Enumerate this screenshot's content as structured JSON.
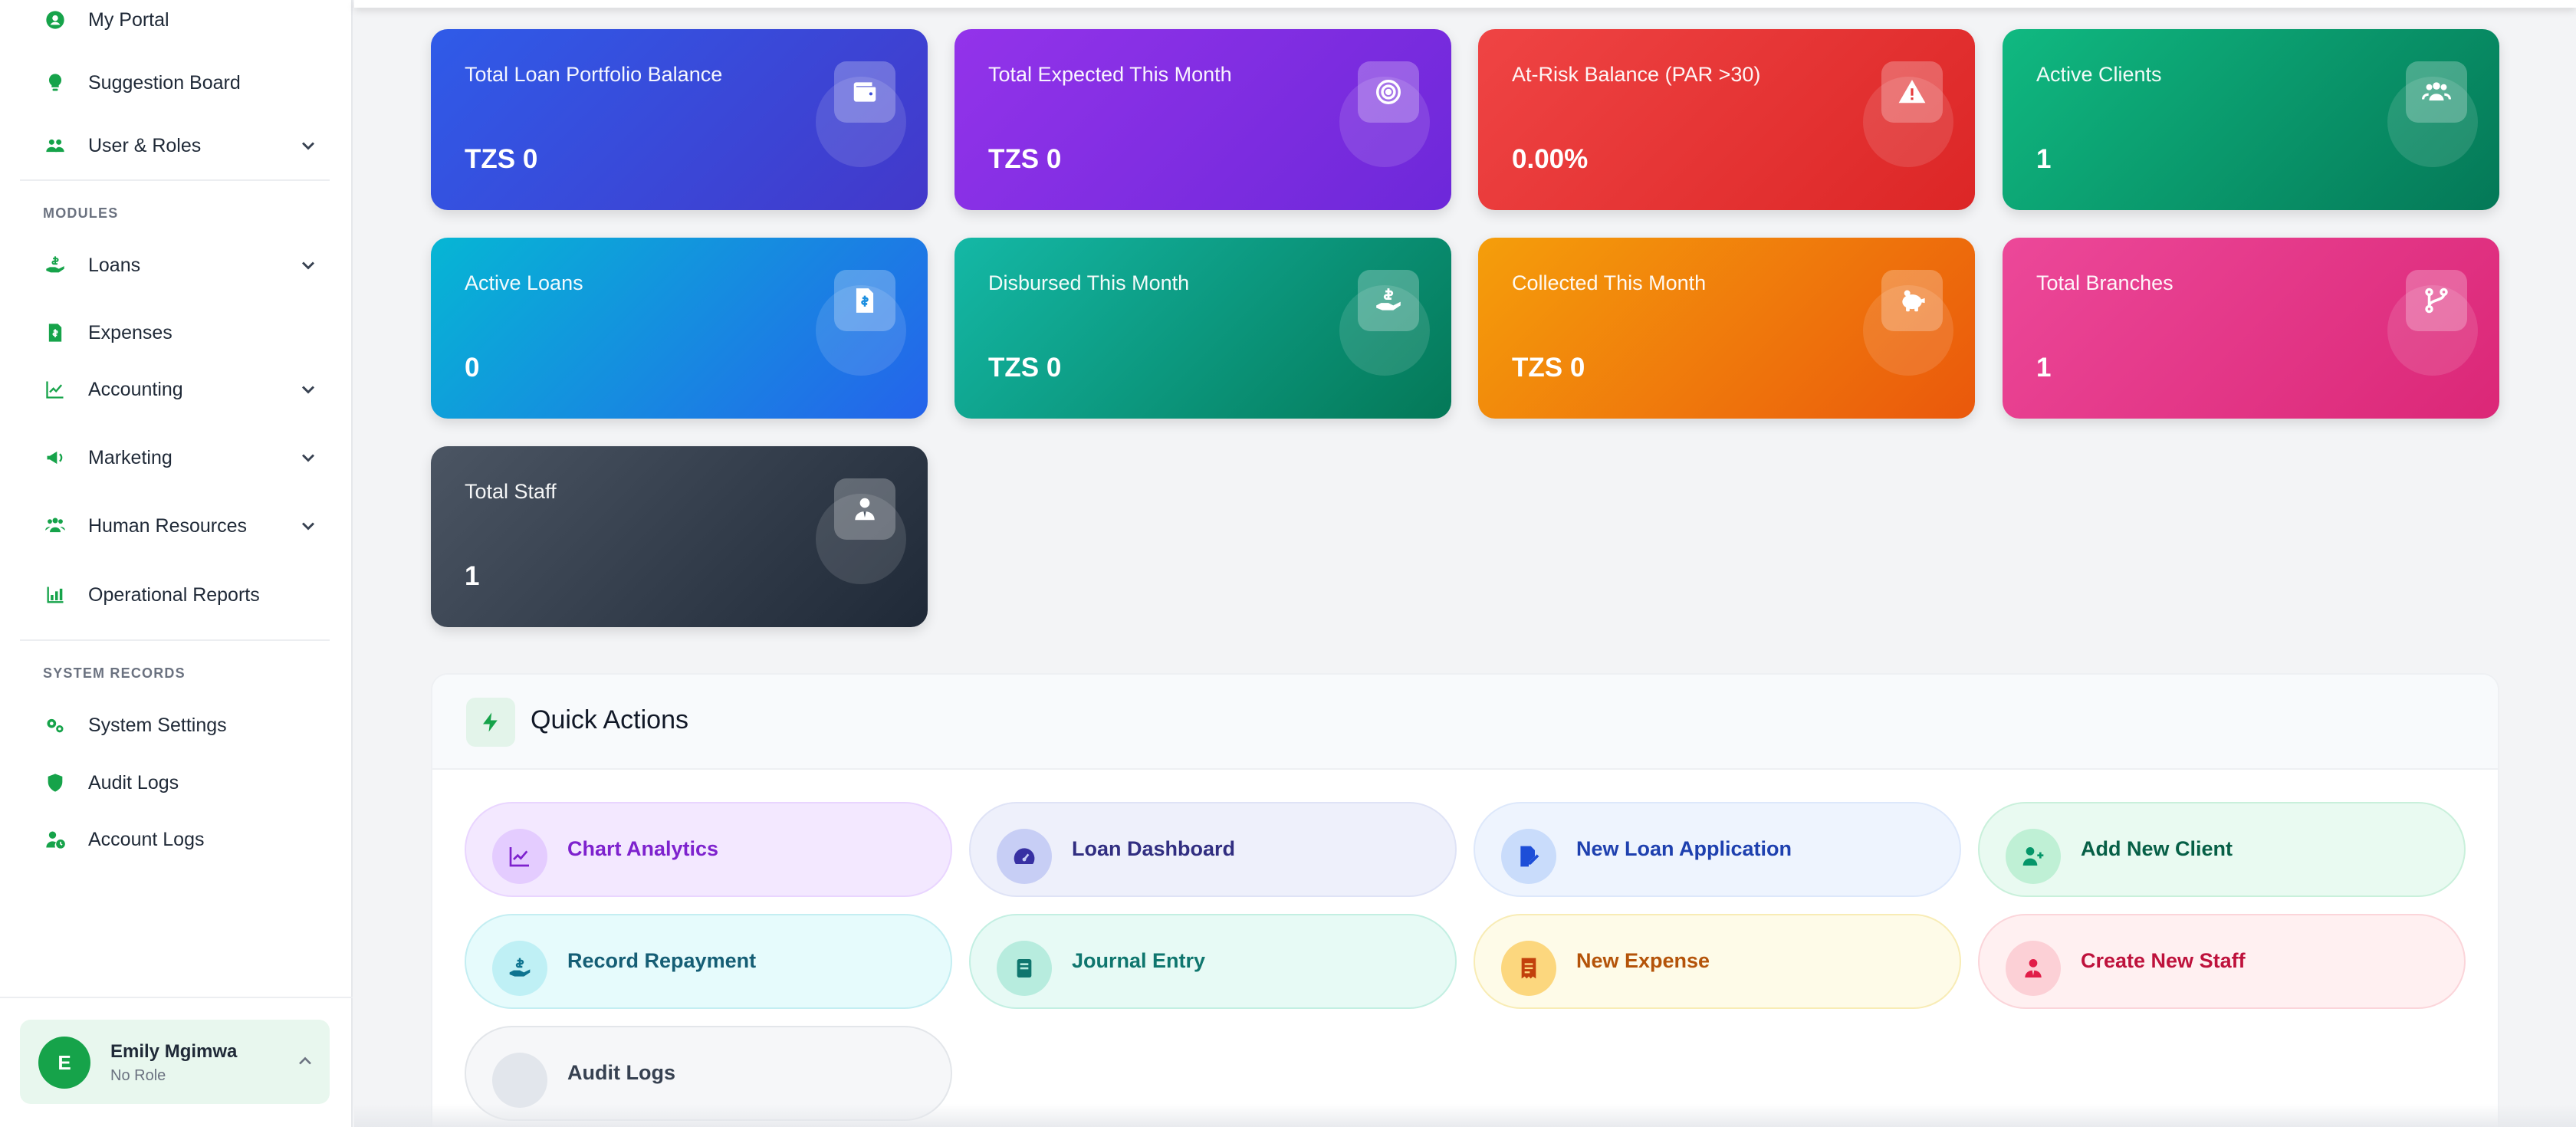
{
  "sidebar": {
    "items_top": [
      {
        "label": "My Portal",
        "icon": "user-circle-icon",
        "expandable": false
      },
      {
        "label": "Suggestion Board",
        "icon": "lightbulb-icon",
        "expandable": false
      },
      {
        "label": "User & Roles",
        "icon": "users-icon",
        "expandable": true
      }
    ],
    "modules_label": "MODULES",
    "modules": [
      {
        "label": "Loans",
        "icon": "hand-holding-dollar-icon",
        "expandable": true
      },
      {
        "label": "Expenses",
        "icon": "receipt-file-icon",
        "expandable": false
      },
      {
        "label": "Accounting",
        "icon": "line-chart-icon",
        "expandable": true
      },
      {
        "label": "Marketing",
        "icon": "megaphone-icon",
        "expandable": true
      },
      {
        "label": "Human Resources",
        "icon": "people-group-icon",
        "expandable": true
      },
      {
        "label": "Operational Reports",
        "icon": "bar-chart-icon",
        "expandable": false
      }
    ],
    "system_label": "SYSTEM RECORDS",
    "system": [
      {
        "label": "System Settings",
        "icon": "gears-icon"
      },
      {
        "label": "Audit Logs",
        "icon": "shield-icon"
      },
      {
        "label": "Account Logs",
        "icon": "user-clock-icon"
      }
    ],
    "user": {
      "initial": "E",
      "name": "Emily Mgimwa",
      "role": "No Role"
    },
    "accent": "#16a34a"
  },
  "stats": [
    {
      "title": "Total Loan Portfolio Balance",
      "value": "TZS 0",
      "icon": "wallet-icon"
    },
    {
      "title": "Total Expected This Month",
      "value": "TZS 0",
      "icon": "target-icon"
    },
    {
      "title": "At-Risk Balance (PAR >30)",
      "value": "0.00%",
      "icon": "warning-triangle-icon"
    },
    {
      "title": "Active Clients",
      "value": "1",
      "icon": "users-icon"
    },
    {
      "title": "Active Loans",
      "value": "0",
      "icon": "invoice-dollar-icon"
    },
    {
      "title": "Disbursed This Month",
      "value": "TZS 0",
      "icon": "hand-dollar-icon"
    },
    {
      "title": "Collected This Month",
      "value": "TZS 0",
      "icon": "piggy-bank-icon"
    },
    {
      "title": "Total Branches",
      "value": "1",
      "icon": "code-branch-icon"
    },
    {
      "title": "Total Staff",
      "value": "1",
      "icon": "user-tie-icon"
    }
  ],
  "quick_actions": {
    "title": "Quick Actions",
    "items": [
      {
        "label": "Chart Analytics",
        "icon": "chart-line-icon"
      },
      {
        "label": "Loan Dashboard",
        "icon": "gauge-icon"
      },
      {
        "label": "New Loan Application",
        "icon": "file-signature-icon"
      },
      {
        "label": "Add New Client",
        "icon": "user-plus-icon"
      },
      {
        "label": "Record Repayment",
        "icon": "hand-dollar-icon"
      },
      {
        "label": "Journal Entry",
        "icon": "book-icon"
      },
      {
        "label": "New Expense",
        "icon": "receipt-icon"
      },
      {
        "label": "Create New Staff",
        "icon": "user-tie-icon"
      },
      {
        "label": "Audit Logs",
        "icon": "blank-icon"
      }
    ]
  }
}
